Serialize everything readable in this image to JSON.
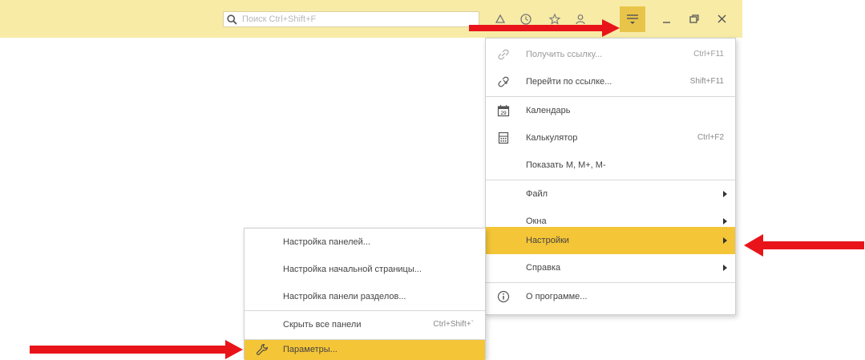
{
  "search": {
    "placeholder": "Поиск Ctrl+Shift+F"
  },
  "icons": {
    "search": "search-icon",
    "main_menu": "main-menu-icon",
    "minimize": "minimize-icon",
    "restore": "restore-icon",
    "close": "close-icon",
    "link": "link-icon",
    "goto_link": "goto-link-icon",
    "calendar": "calendar-icon",
    "calculator": "calculator-icon",
    "info": "info-icon",
    "wrench": "wrench-icon",
    "annotation_arrow": "red-arrow-icon"
  },
  "calendar_icon_day": "29",
  "main_menu": {
    "items": [
      {
        "label": "Получить ссылку...",
        "shortcut": "Ctrl+F11"
      },
      {
        "label": "Перейти по ссылке...",
        "shortcut": "Shift+F11"
      },
      {
        "label": "Календарь",
        "shortcut": ""
      },
      {
        "label": "Калькулятор",
        "shortcut": "Ctrl+F2"
      },
      {
        "label": "Показать M, M+, M-",
        "shortcut": ""
      },
      {
        "label": "Файл",
        "shortcut": ""
      },
      {
        "label": "Окна",
        "shortcut": ""
      },
      {
        "label": "Настройки",
        "shortcut": ""
      },
      {
        "label": "Справка",
        "shortcut": ""
      },
      {
        "label": "О программе...",
        "shortcut": ""
      }
    ]
  },
  "settings_submenu": {
    "items": [
      {
        "label": "Настройка панелей...",
        "shortcut": ""
      },
      {
        "label": "Настройка начальной страницы...",
        "shortcut": ""
      },
      {
        "label": "Настройка панели разделов...",
        "shortcut": ""
      },
      {
        "label": "Скрыть все панели",
        "shortcut": "Ctrl+Shift+`"
      },
      {
        "label": "Параметры...",
        "shortcut": ""
      }
    ]
  },
  "colors": {
    "topbar": "#f7eba6",
    "highlight": "#f4c537",
    "annotation": "#e8141a"
  }
}
